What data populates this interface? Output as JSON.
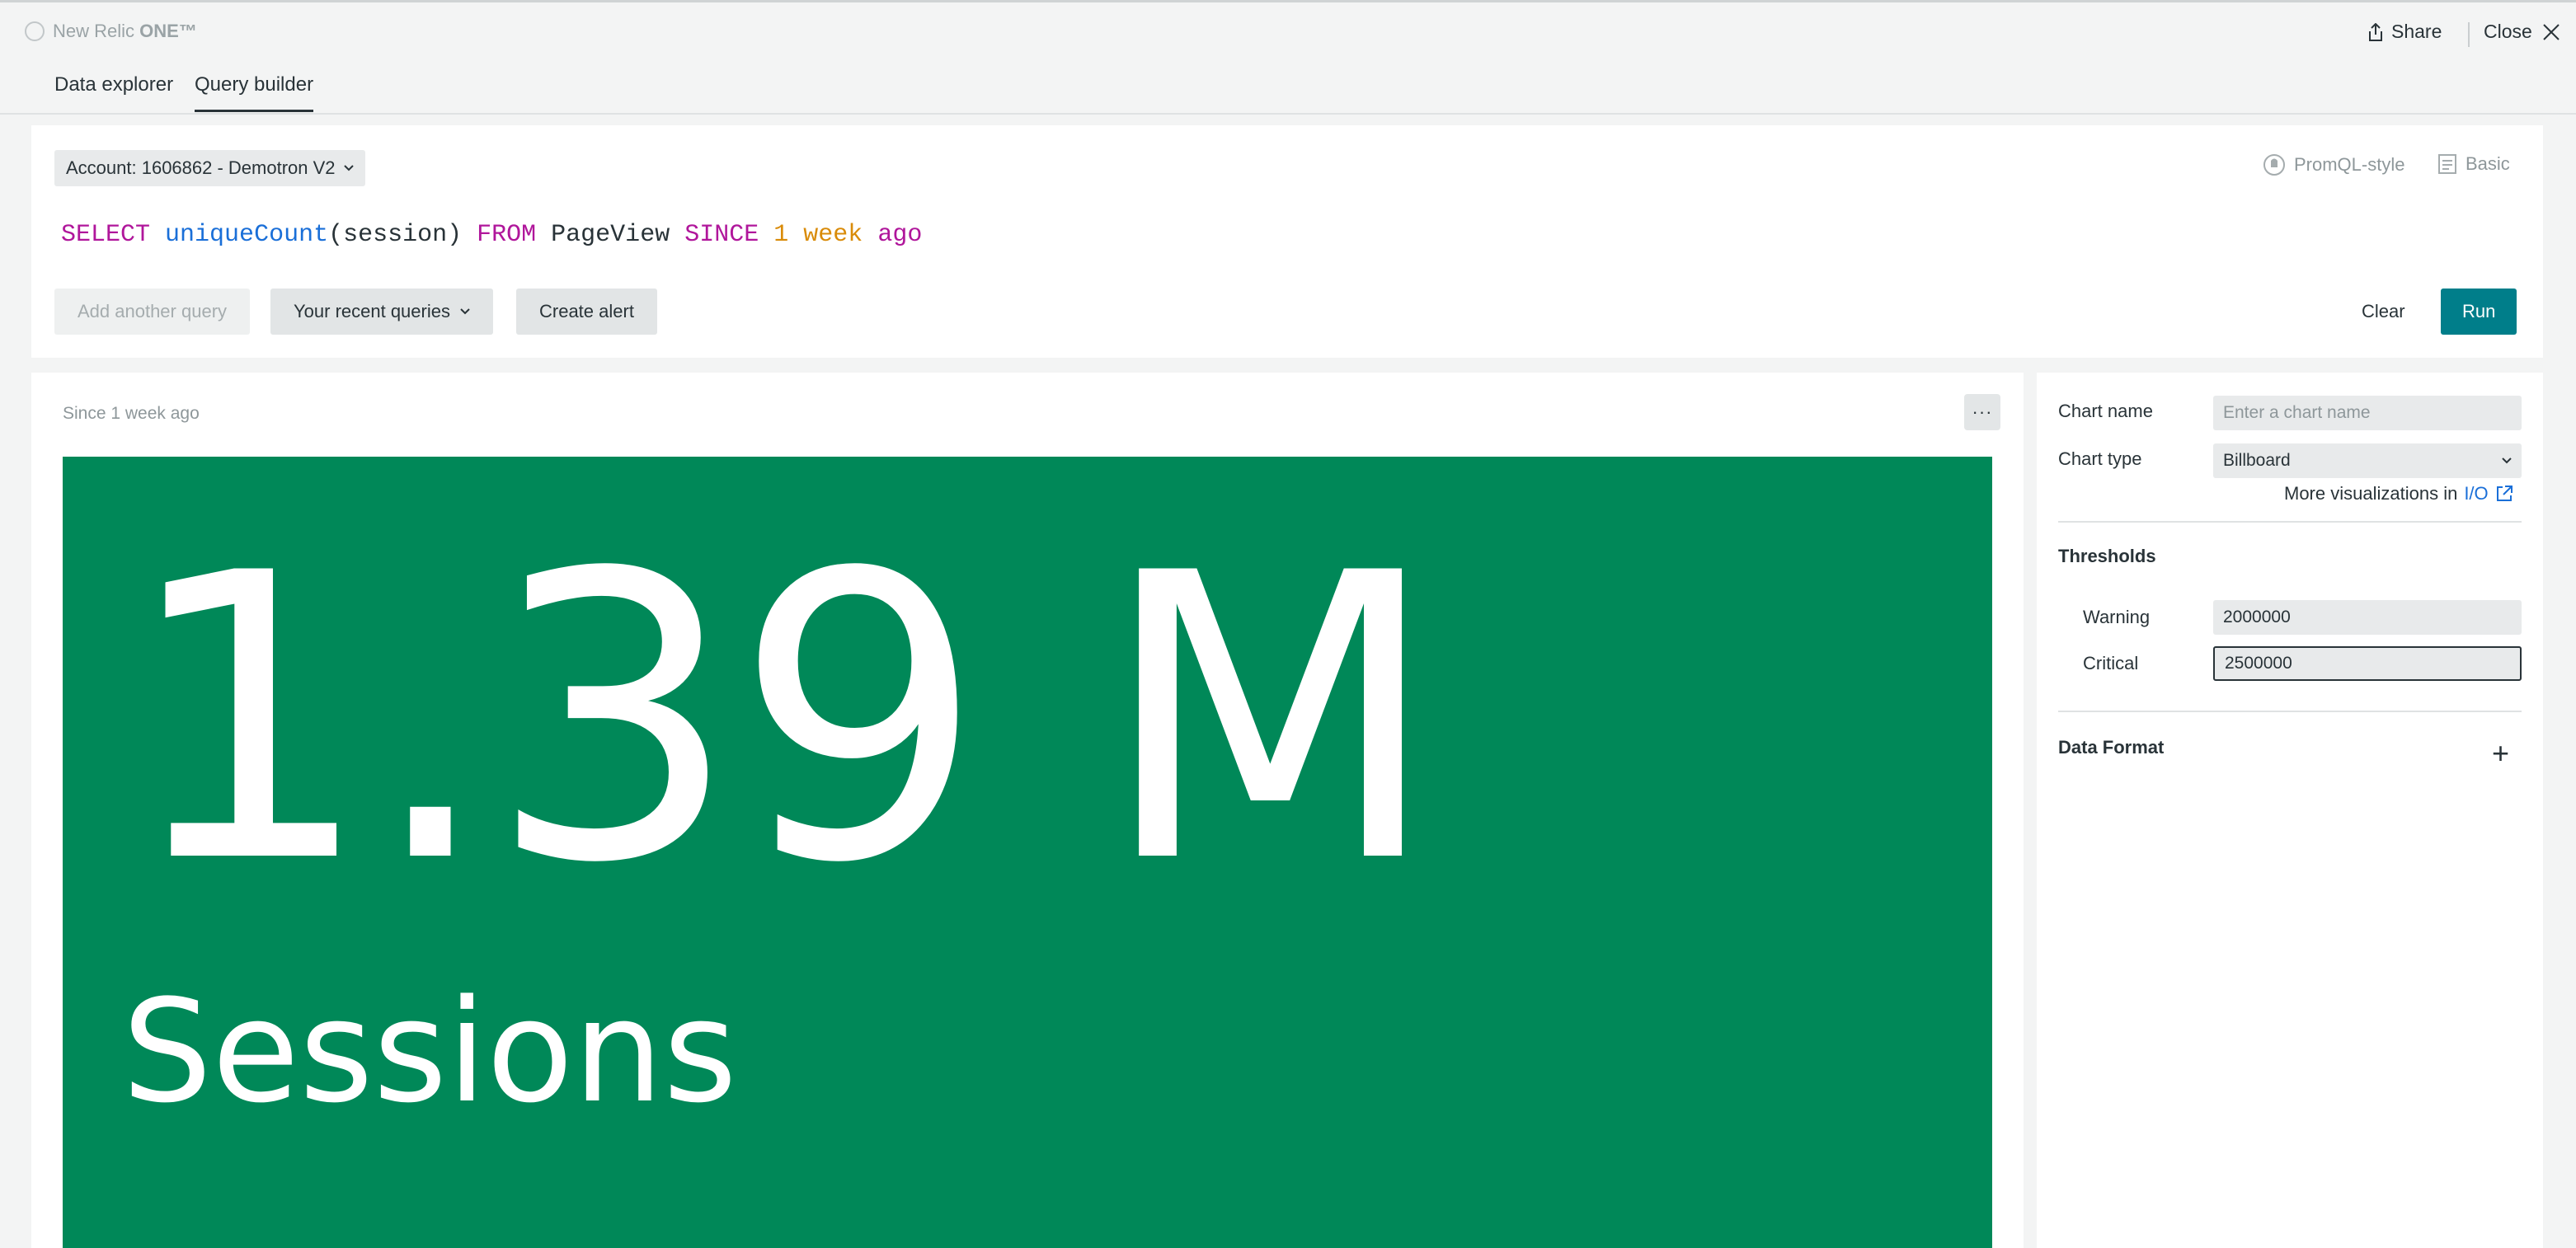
{
  "app": {
    "brand_prefix": "New Relic ",
    "brand_strong": "ONE™"
  },
  "header": {
    "share_label": "Share",
    "close_label": "Close"
  },
  "tabs": [
    {
      "label": "Data explorer",
      "active": false
    },
    {
      "label": "Query builder",
      "active": true
    }
  ],
  "query_panel": {
    "account_label": "Account: 1606862 - Demotron V2",
    "promql_label": "PromQL-style",
    "basic_label": "Basic",
    "query_tokens": {
      "select": "SELECT",
      "fn": "uniqueCount",
      "args": "(session)",
      "from": "FROM",
      "table": "PageView",
      "since": "SINCE",
      "num": "1",
      "unit": "week",
      "ago": "ago"
    },
    "buttons": {
      "add_query": "Add another query",
      "recent_queries": "Your recent queries",
      "create_alert": "Create alert",
      "clear": "Clear",
      "run": "Run"
    }
  },
  "chart_panel": {
    "since_label": "Since 1 week ago",
    "menu_label": "···",
    "billboard": {
      "value": "1.39 M",
      "label": "Sessions",
      "status_color": "#008858"
    }
  },
  "settings": {
    "chart_name_label": "Chart name",
    "chart_name_placeholder": "Enter a chart name",
    "chart_type_label": "Chart type",
    "chart_type_value": "Billboard",
    "more_viz_text": "More visualizations in",
    "more_viz_link": "I/O",
    "thresholds_title": "Thresholds",
    "warning_label": "Warning",
    "warning_value": "2000000",
    "critical_label": "Critical",
    "critical_value": "2500000",
    "data_format_title": "Data Format",
    "add_label": "+"
  },
  "colors": {
    "accent": "#007e8a",
    "keyword": "#b0169b",
    "function": "#1a6fd8",
    "number": "#d98b09",
    "billboard_bg": "#008858"
  },
  "icons": {
    "brand": "new-relic-logo-icon",
    "share": "share-icon",
    "close": "close-icon",
    "account_chevron": "chevron-down-icon",
    "promql": "promql-icon",
    "basic": "basic-mode-icon",
    "recent_chevron": "chevron-down-icon",
    "external_link": "external-link-icon",
    "add": "plus-icon"
  }
}
